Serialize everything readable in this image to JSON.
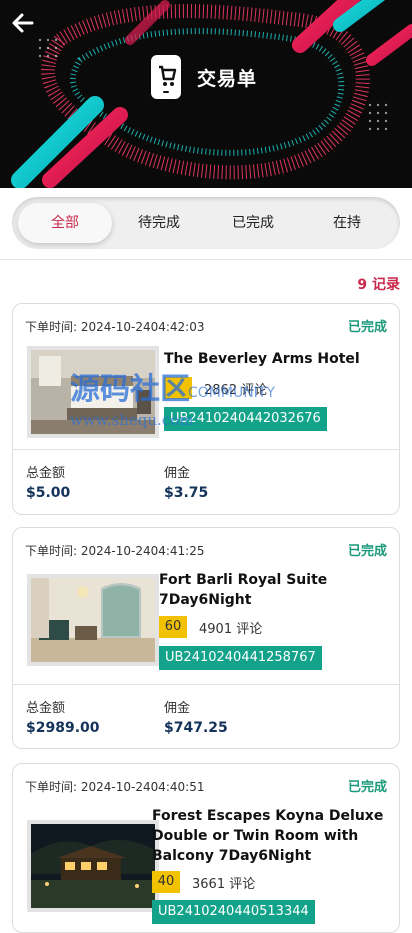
{
  "header": {
    "title": "交易单",
    "back_icon": "arrow-left-icon",
    "app_icon": "phone-cart-icon"
  },
  "tabs": [
    {
      "label": "全部",
      "active": true
    },
    {
      "label": "待完成",
      "active": false
    },
    {
      "label": "已完成",
      "active": false
    },
    {
      "label": "在持",
      "active": false
    }
  ],
  "records": {
    "count_label": "9 记录"
  },
  "watermark": {
    "main": "源码社区",
    "sub": "COMMUNITY",
    "url": "www.shequ.com"
  },
  "orders": [
    {
      "time": "下单时间: 2024-10-2404:42:03",
      "status": "已完成",
      "hotel": "The Beverley Arms Hotel",
      "rating": "",
      "reviews": "2862 评论",
      "code": "UB2410240442032676",
      "total_label": "总金额",
      "total": "$5.00",
      "commission_label": "佣金",
      "commission": "$3.75"
    },
    {
      "time": "下单时间: 2024-10-2404:41:25",
      "status": "已完成",
      "hotel_line1": "Fort Barli Royal Suite",
      "hotel_line2": "7Day6Night",
      "rating": "60",
      "reviews": "4901 评论",
      "code": "UB2410240441258767",
      "total_label": "总金额",
      "total": "$2989.00",
      "commission_label": "佣金",
      "commission": "$747.25"
    },
    {
      "time": "下单时间: 2024-10-2404:40:51",
      "status": "已完成",
      "hotel_line1": "Forest Escapes Koyna Deluxe",
      "hotel_line2": "Double or Twin Room with",
      "hotel_line3": "Balcony 7Day6Night",
      "rating": "40",
      "reviews": "3661 评论",
      "code": "UB2410240440513344"
    }
  ]
}
